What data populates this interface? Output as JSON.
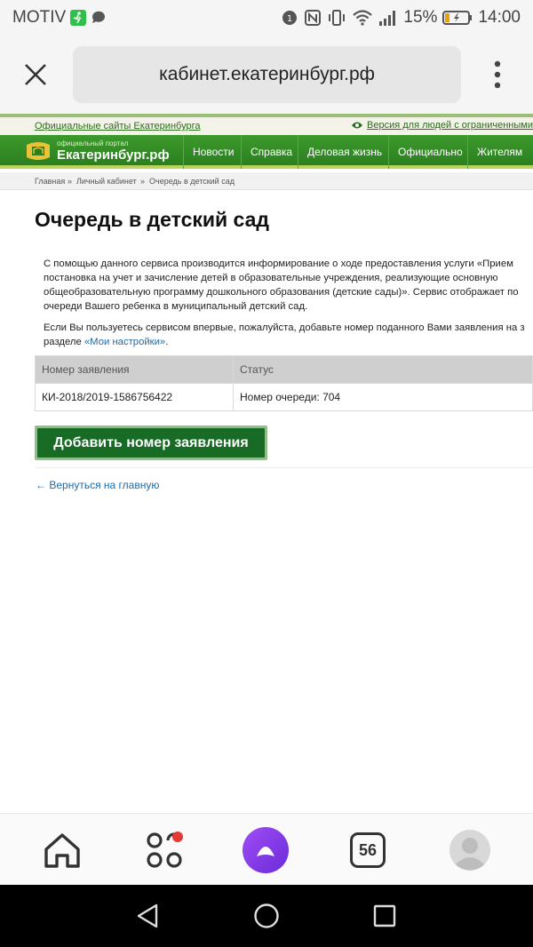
{
  "status_bar": {
    "carrier": "MOTIV",
    "battery_percent": "15%",
    "time": "14:00",
    "icons": [
      "running-person-icon",
      "chat-bubble-icon",
      "alarm-icon",
      "nfc-icon",
      "vibrate-icon",
      "wifi-icon",
      "signal-icon",
      "battery-icon"
    ]
  },
  "browser": {
    "url": "кабинет.екатеринбург.рф",
    "close_icon": "close-icon",
    "menu_icon": "more-vertical-icon"
  },
  "site": {
    "top_left_link": "Официальные сайты Екатеринбурга",
    "accessibility_link": "Версия для людей с ограниченными во",
    "portal_small": "официальный портал",
    "portal_name": "Екатеринбург.рф",
    "nav": [
      "Новости",
      "Справка",
      "Деловая жизнь",
      "Официально",
      "Жителям"
    ],
    "breadcrumb": {
      "item1": "Главная",
      "sep": "»",
      "item2": "Личный кабинет",
      "item3": "Очередь в детский сад"
    }
  },
  "main": {
    "title": "Очередь в детский сад",
    "intro_lines": [
      "С помощью данного сервиса производится информирование о ходе предоставления услуги «Прием",
      "постановка на учет и зачисление детей в образовательные учреждения, реализующие основную",
      "общеобразовательную программу дошкольного образования (детские сады)». Сервис отображает по",
      "очереди Вашего ребенка в муниципальный детский сад."
    ],
    "second_line1": "Если Вы пользуетесь сервисом впервые, пожалуйста, добавьте номер поданного Вами заявления на з",
    "second_line2_prefix": "разделе ",
    "settings_link": "«Мои настройки»",
    "second_line2_suffix": ".",
    "table": {
      "headers": [
        "Номер заявления",
        "Статус"
      ],
      "rows": [
        [
          "КИ-2018/2019-1586756422",
          "Номер очереди: 704"
        ]
      ]
    },
    "add_button": "Добавить номер заявления",
    "back_arrow": "←",
    "back_link": "Вернуться на главную"
  },
  "toolbar": {
    "tabs_count": "56",
    "items": [
      "home-icon",
      "services-grid-icon",
      "alice-assistant-icon",
      "tabs-counter",
      "profile-avatar"
    ],
    "notification_color": "#e53935",
    "alice_color": "#8a2be2"
  },
  "android_nav": [
    "back-icon",
    "home-circle-icon",
    "recents-icon"
  ]
}
